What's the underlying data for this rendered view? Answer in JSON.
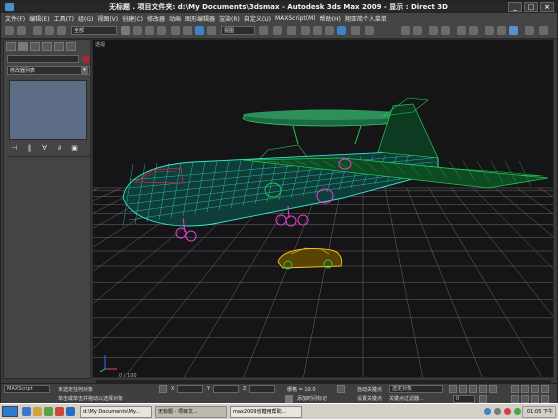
{
  "window": {
    "title": "无标题   . 项目文件夹: d:\\My Documents\\3dsmax   - Autodesk 3ds Max  2009    - 显示 : Direct 3D",
    "minimize": "_",
    "maximize": "□",
    "close": "×"
  },
  "menu": [
    "文件(F)",
    "编辑(E)",
    "工具(T)",
    "组(G)",
    "视图(V)",
    "创建(C)",
    "修改器",
    "动画",
    "图形编辑器",
    "渲染(R)",
    "自定义(U)",
    "MAXScript(M)",
    "帮助(H)",
    "翔亚简个人菜单"
  ],
  "toolbar": {
    "selection_filter": "全部",
    "ref_coord": "视图"
  },
  "command_panel": {
    "modifier_list": "修改器列表",
    "icons": [
      "pin-stack",
      "show-end-result",
      "make-unique",
      "remove-modifier",
      "configure-modifier-sets"
    ]
  },
  "viewport": {
    "label": "透视",
    "scene": "aircraft-and-car-wireframe",
    "colors": {
      "background": "#151517",
      "grid": "#6b6b6b",
      "fuselage": "#38e8cf",
      "wing_mesh": "#22c84e",
      "radome_top": "#2d8f5a",
      "accent_red": "#d9243a",
      "accent_magenta": "#e33fd0",
      "car": "#f4c61e"
    }
  },
  "timeline": {
    "frame_label": "0 / 100"
  },
  "status": {
    "script_label": "MAXScript",
    "selection_status": "未选定任何对象",
    "hint": "单击或单击并拖动以选择对象",
    "x_label": "X",
    "y_label": "Y",
    "z_label": "Z",
    "grid": "栅格 = 10.0",
    "add_time_tag": "添加时间标记",
    "auto_key": "自动关键点",
    "selected_set": "选定对象",
    "set_key": "设置关键点",
    "key_filters": "关键点过滤器...",
    "frame": "0"
  },
  "taskbar": {
    "tasks": [
      "d:\\My Documents\\My...",
      "无标题 - 项目文...",
      "max2009省糖用帮助..."
    ],
    "clock": "01:05 下午"
  }
}
